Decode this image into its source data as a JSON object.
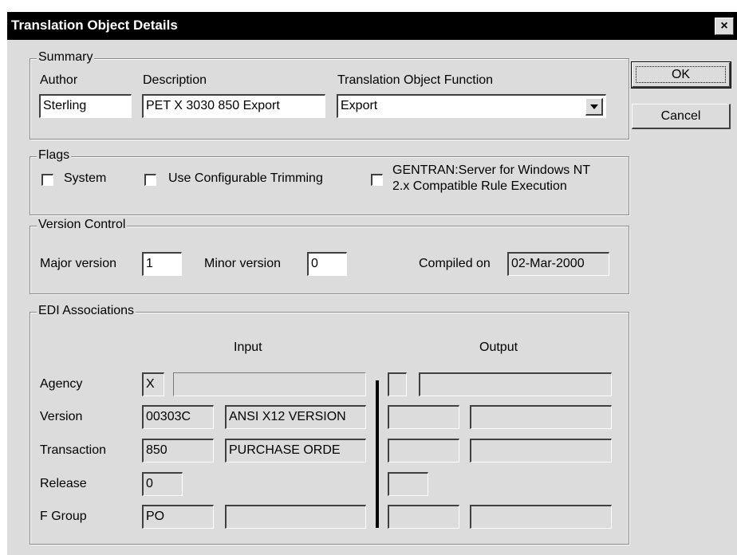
{
  "window": {
    "title": "Translation Object Details",
    "close_symbol": "×"
  },
  "buttons": {
    "ok": "OK",
    "cancel": "Cancel"
  },
  "summary": {
    "title": "Summary",
    "author_label": "Author",
    "author_value": "Sterling",
    "description_label": "Description",
    "description_value": "PET X 3030 850 Export",
    "function_label": "Translation Object Function",
    "function_value": "Export"
  },
  "flags": {
    "title": "Flags",
    "system_label": "System",
    "trimming_label": "Use Configurable Trimming",
    "gentran_label_1": "GENTRAN:Server for Windows NT",
    "gentran_label_2": "2.x Compatible Rule Execution",
    "system_checked": false,
    "trimming_checked": false,
    "gentran_checked": false
  },
  "version_control": {
    "title": "Version Control",
    "major_label": "Major version",
    "major_value": "1",
    "minor_label": "Minor version",
    "minor_value": "0",
    "compiled_label": "Compiled on",
    "compiled_value": "02-Mar-2000"
  },
  "edi": {
    "title": "EDI Associations",
    "input_header": "Input",
    "output_header": "Output",
    "rows": {
      "agency": {
        "label": "Agency",
        "input_code": "X",
        "input_desc": ""
      },
      "version": {
        "label": "Version",
        "input_code": "00303C",
        "input_desc": "ANSI X12 VERSION"
      },
      "transaction": {
        "label": "Transaction",
        "input_code": "850",
        "input_desc": "PURCHASE ORDE"
      },
      "release": {
        "label": "Release",
        "input_code": "0"
      },
      "fgroup": {
        "label": "F Group",
        "input_code": "PO",
        "input_desc": ""
      }
    }
  }
}
